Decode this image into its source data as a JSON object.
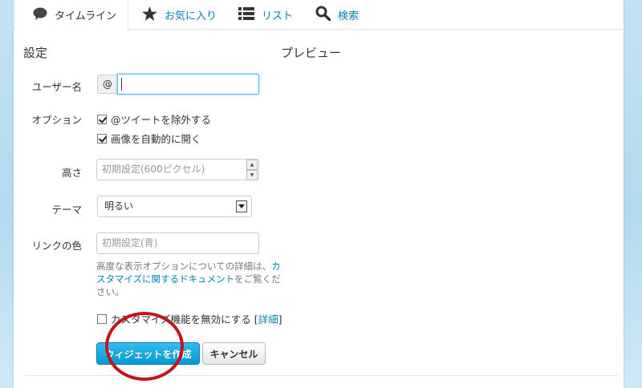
{
  "tabs": [
    {
      "label": "タイムライン",
      "icon": "speech-bubble-icon",
      "active": true
    },
    {
      "label": "お気に入り",
      "icon": "star-icon",
      "active": false
    },
    {
      "label": "リスト",
      "icon": "list-icon",
      "active": false
    },
    {
      "label": "検索",
      "icon": "search-icon",
      "active": false
    }
  ],
  "settings": {
    "title": "設定",
    "username": {
      "label": "ユーザー名",
      "prefix": "@",
      "value": ""
    },
    "options": {
      "label": "オプション",
      "exclude_replies": {
        "label": "@ツイートを除外する",
        "checked": true
      },
      "auto_expand_photos": {
        "label": "画像を自動的に開く",
        "checked": true
      }
    },
    "height": {
      "label": "高さ",
      "placeholder": "初期設定(600ピクセル)"
    },
    "theme": {
      "label": "テーマ",
      "selected": "明るい"
    },
    "link_color": {
      "label": "リンクの色",
      "placeholder": "初期設定(青)"
    },
    "help": {
      "prefix": "高度な表示オプションについての詳細は、",
      "link": "カスタマイズに関するドキュメント",
      "suffix": "をご覧ください。"
    },
    "disable_customization": {
      "label": "カスタマイズ機能を無効にする",
      "link": "詳細",
      "checked": false
    },
    "create_button": "ウィジェットを作成",
    "cancel_button": "キャンセル"
  },
  "preview": {
    "title": "プレビュー"
  },
  "colors": {
    "accent": "#0084b4",
    "primary_button": "#019ad2",
    "annotation": "#c4151c",
    "background": "#b2daef"
  }
}
